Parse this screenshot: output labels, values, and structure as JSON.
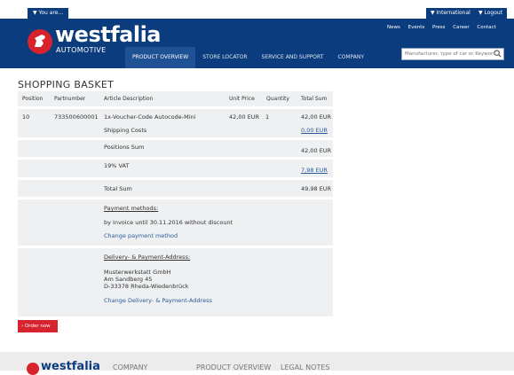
{
  "topbar": {
    "you_are": "▼ You are...",
    "international": "▼ International",
    "logout": "▼ Logout"
  },
  "header": {
    "logo_text": "westfalia",
    "logo_sub": "AUTOMOTIVE",
    "toplinks": [
      "News",
      "Events",
      "Press",
      "Career",
      "Contact"
    ],
    "nav": [
      "PRODUCT OVERVIEW",
      "STORE LOCATOR",
      "SERVICE AND SUPPORT",
      "COMPANY"
    ],
    "search_placeholder": "Manufacturer, type of car or Keyword"
  },
  "page_title": "SHOPPING BASKET",
  "table": {
    "headers": [
      "Position",
      "Partnumber",
      "Article Description",
      "Unit Price",
      "Quantity",
      "Total Sum"
    ],
    "item": {
      "position": "10",
      "partnumber": "733500600001",
      "description": "1x-Voucher-Code Autocode-Mini",
      "unit_price": "42,00 EUR",
      "quantity": "1",
      "total": "42,00 EUR"
    },
    "shipping_label": "Shipping Costs",
    "shipping_value": "0,00 EUR",
    "positions_sum_label": "Positions Sum",
    "positions_sum_value": "42,00 EUR",
    "vat_label": "19% VAT",
    "vat_value": "7,98 EUR",
    "total_label": "Total Sum",
    "total_value": "49,98 EUR",
    "payment_title": "Payment methods:",
    "payment_text": "by invoice until 30.11.2016 without discount",
    "payment_change": "Change payment method",
    "address_title": "Delivery- & Payment-Address:",
    "address_line1": "Musterwerkstatt GmbH",
    "address_line2": "Am Sandberg 45",
    "address_line3": "D-33378 Rheda-Wiedenbrück",
    "address_change": "Change Delivery- & Payment-Address"
  },
  "order_button": "Order now",
  "footer": {
    "logo_text": "westfalia",
    "links": [
      "COMPANY",
      "PRODUCT OVERVIEW",
      "LEGAL NOTES"
    ]
  },
  "colors": {
    "navy": "#0b3c7d",
    "red": "#d7232e",
    "light": "#eef0f2",
    "link": "#2a5b9a"
  }
}
